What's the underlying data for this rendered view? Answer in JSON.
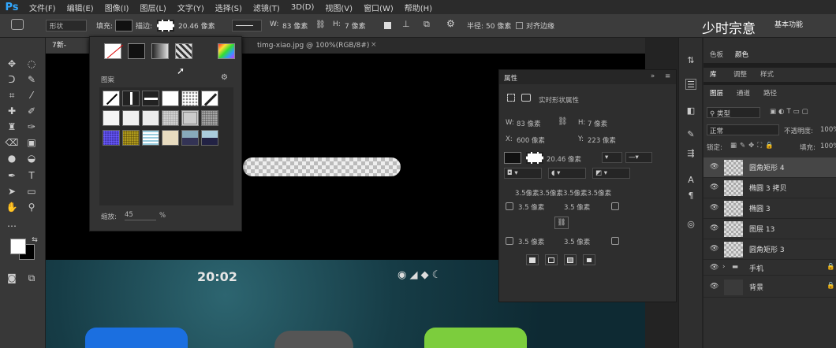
{
  "app": {
    "logo": "Ps"
  },
  "menu": [
    "文件(F)",
    "编辑(E)",
    "图像(I)",
    "图层(L)",
    "文字(Y)",
    "选择(S)",
    "滤镜(T)",
    "3D(D)",
    "视图(V)",
    "窗口(W)",
    "帮助(H)"
  ],
  "options": {
    "mode": "形状",
    "fill_label": "填充:",
    "stroke_label": "描边:",
    "stroke_width": "20.46 像素",
    "w_label": "W:",
    "w_value": "83 像素",
    "h_label": "H:",
    "h_value": "7 像素",
    "radius_label": "半径:",
    "radius_value": "50 像素",
    "align_edges": "对齐边缘"
  },
  "doc_tabs": [
    {
      "label": "7新-iPhone"
    },
    {
      "label": "timg-xiao.jpg @ 100%(RGB/8#)"
    }
  ],
  "pattern_panel": {
    "title": "图案",
    "scale_label": "缩放:",
    "scale_value": "45",
    "scale_unit": "%"
  },
  "canvas": {
    "time": "20:02"
  },
  "properties": {
    "title": "属性",
    "subtitle": "实时形状属性",
    "w_label": "W:",
    "w_value": "83 像素",
    "h_label": "H:",
    "h_value": "7 像素",
    "x_label": "X:",
    "x_value": "600 像素",
    "y_label": "Y:",
    "y_value": "223 像素",
    "stroke_width": "20.46 像素",
    "corners_all": "3.5像素3.5像素3.5像素3.5像素",
    "corner_tl": "3.5 像素",
    "corner_tr": "3.5 像素",
    "corner_bl": "3.5 像素",
    "corner_br": "3.5 像素"
  },
  "right_tabs": {
    "top": [
      "色板",
      "颜色"
    ],
    "mid": [
      "库",
      "调整",
      "样式"
    ],
    "layers_tabs": [
      "图层",
      "通道",
      "路径"
    ]
  },
  "layers_panel": {
    "filter_label": "类型",
    "blend_mode": "正常",
    "opacity_label": "不透明度:",
    "opacity_value": "100%",
    "lock_label": "锁定:",
    "fill_label": "填充:",
    "fill_value": "100%",
    "layers": [
      {
        "name": "圆角矩形 4"
      },
      {
        "name": "椭圆 3 拷贝"
      },
      {
        "name": "椭圆 3"
      },
      {
        "name": "图层 13"
      },
      {
        "name": "圆角矩形 3"
      },
      {
        "name": "手机"
      },
      {
        "name": "背景"
      }
    ]
  },
  "watermark": {
    "text": "少时宗意",
    "extra": "基本功能"
  }
}
